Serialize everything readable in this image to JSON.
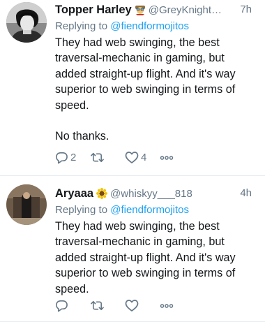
{
  "tweets": [
    {
      "name": "Topper Harley",
      "handle": "@GreyKnight…",
      "time": "7h",
      "badge_icon": "aviator-emoji-icon",
      "replying_prefix": "Replying to",
      "replying_handle": "@fiendformojitos",
      "text": [
        "They had web swinging, the best traversal-mechanic in gaming, but added straight-up flight. And it's way superior to web swinging in terms of speed.",
        "No thanks."
      ],
      "reply_count": "2",
      "retweet_count": "",
      "like_count": "4"
    },
    {
      "name": "Aryaaa",
      "handle": "@whiskyy___818",
      "time": "4h",
      "badge_icon": "sunflower-emoji-icon",
      "replying_prefix": "Replying to",
      "replying_handle": "@fiendformojitos",
      "text": [
        "They had web swinging, the best traversal-mechanic in gaming, but added straight-up flight. And it's way superior to web swinging in terms of speed."
      ],
      "reply_count": "",
      "retweet_count": "",
      "like_count": ""
    }
  ],
  "colors": {
    "link": "#1da1f2",
    "secondary_text": "#657786",
    "primary_text": "#14171a",
    "divider": "#e6ecf0"
  },
  "icons": [
    "reply-icon",
    "retweet-icon",
    "like-icon",
    "more-icon"
  ]
}
